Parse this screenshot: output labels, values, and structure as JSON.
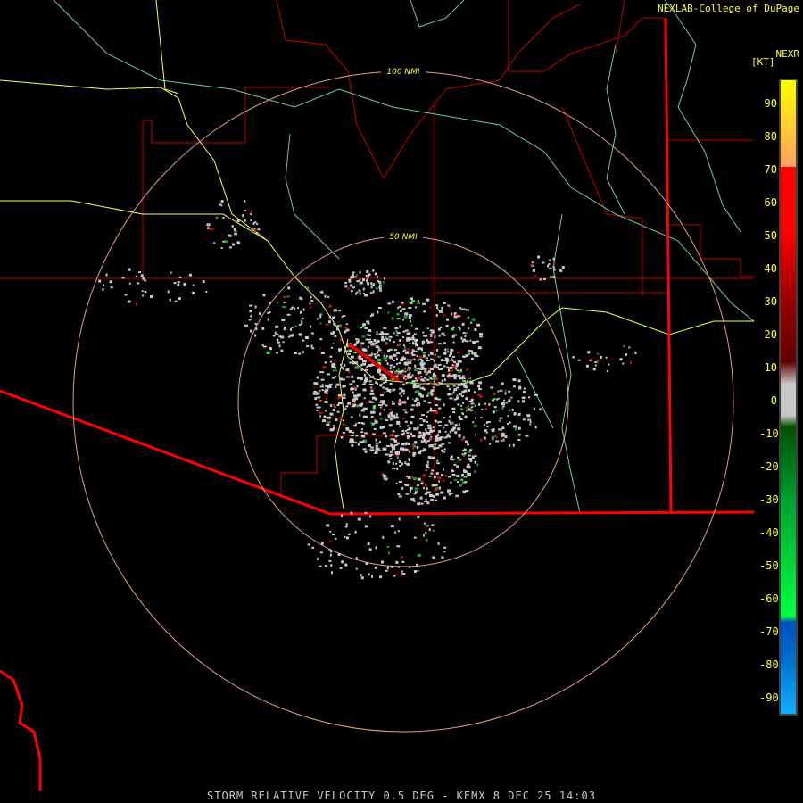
{
  "credit": "NEXLAB-College of DuPage",
  "product_code": "NEXR",
  "units": "[KT]",
  "footer": "STORM RELATIVE VELOCITY 0.5 DEG - KEMX 8 DEC 25 14:03",
  "ring_labels": [
    "100 NMI",
    "50 NMI"
  ],
  "colorbar": {
    "ticks": [
      "90",
      "80",
      "70",
      "60",
      "50",
      "40",
      "30",
      "20",
      "10",
      "0",
      "-10",
      "-20",
      "-30",
      "-40",
      "-50",
      "-60",
      "-70",
      "-80",
      "-90"
    ],
    "colors": {
      "high": "#ffff00",
      "orange": "#ffa060",
      "red": "#ff0000",
      "darkred": "#600000",
      "zero": "#c8c8c8",
      "darkgreen": "#005000",
      "green": "#00ff40",
      "blue": "#0050c0",
      "lightblue": "#10b0ff"
    }
  },
  "colors": {
    "background": "#000000",
    "county": "#c00000",
    "state": "#ff0000",
    "highway": "#ffff50",
    "river": "#70d090",
    "ring": "#e0a080"
  }
}
